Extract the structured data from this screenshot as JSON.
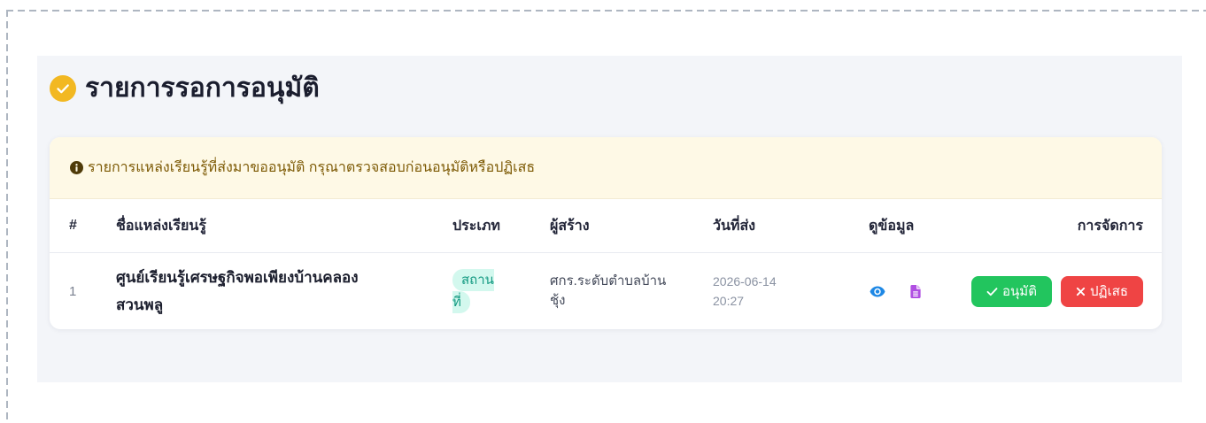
{
  "page": {
    "title": "รายการรอการอนุมัติ",
    "title_icon": "check-circle-icon"
  },
  "alert": {
    "icon": "info-circle-icon",
    "text": "รายการแหล่งเรียนรู้ที่ส่งมาขออนุมัติ กรุณาตรวจสอบก่อนอนุมัติหรือปฏิเสธ"
  },
  "table": {
    "columns": [
      "#",
      "ชื่อแหล่งเรียนรู้",
      "ประเภท",
      "ผู้สร้าง",
      "วันที่ส่ง",
      "ดูข้อมูล",
      "การจัดการ"
    ],
    "rows": [
      {
        "index": "1",
        "name": "ศูนย์เรียนรู้เศรษฐกิจพอเพียงบ้านคลองสวนพลู",
        "type": "สถานที่",
        "creator": "ศกร.ระดับตำบลบ้านชุ้ง",
        "submitted": "2026-06-14 20:27",
        "view_icons": [
          "eye-icon",
          "file-alt-icon"
        ],
        "actions": {
          "approve": {
            "label": "อนุมัติ",
            "icon": "check-icon"
          },
          "reject": {
            "label": "ปฏิเสธ",
            "icon": "times-icon"
          }
        }
      }
    ]
  },
  "colors": {
    "accent": "#f2b822",
    "panel_background": "#f3f5f9",
    "alert_background": "#fef9e6",
    "alert_text": "#7d5a05",
    "alert_icon": "#4f3b08",
    "view_icon": "#1e88e5",
    "document_icon": "#b04fe2",
    "badge_background": "#d3f8ee",
    "badge_text": "#149a82",
    "approve": "#22c55e",
    "reject": "#ef4444"
  }
}
